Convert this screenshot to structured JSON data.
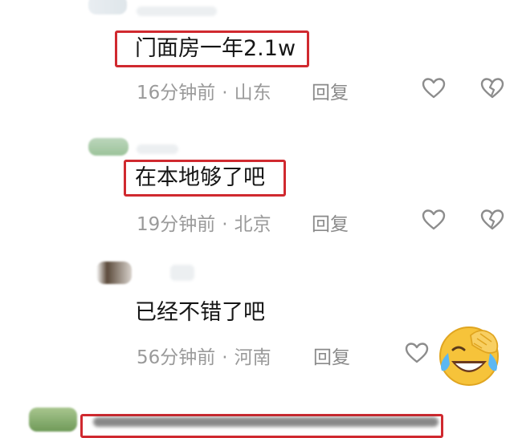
{
  "comments": [
    {
      "content": "门面房一年2.1w",
      "time": "16分钟前",
      "location": "山东",
      "reply_label": "回复"
    },
    {
      "content": "在本地够了吧",
      "time": "19分钟前",
      "location": "北京",
      "reply_label": "回复"
    },
    {
      "content": "已经不错了吧",
      "time": "56分钟前",
      "location": "河南",
      "reply_label": "回复"
    }
  ],
  "separator": "·",
  "icons": {
    "like": "heart-outline-icon",
    "dislike": "broken-heart-icon",
    "emoji": "crying-laughing-emoji"
  },
  "colors": {
    "highlight_border": "#d0292f",
    "meta_text": "#9a9a9a",
    "emoji_yellow": "#f6c33a"
  }
}
